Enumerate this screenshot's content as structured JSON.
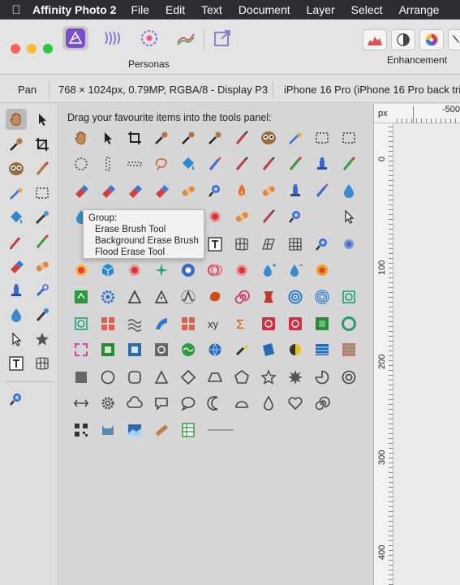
{
  "menubar": {
    "app_name": "Affinity Photo 2",
    "items": [
      "File",
      "Edit",
      "Text",
      "Document",
      "Layer",
      "Select",
      "Arrange"
    ]
  },
  "toolbar": {
    "personas_label": "Personas",
    "enhancement_label": "Enhancement"
  },
  "context": {
    "tool_name": "Pan",
    "doc_info": "768 × 1024px, 0.79MP, RGBA/8 - Display P3",
    "camera": "iPhone 16 Pro (iPhone 16 Pro back trip"
  },
  "sheet": {
    "title": "Drag your favourite items into the tools panel:"
  },
  "tooltip": {
    "heading": "Group:",
    "items": [
      "Erase Brush Tool",
      "Background Erase Brush",
      "Flood Erase Tool"
    ]
  },
  "ruler": {
    "unit": "px",
    "top_label": "-500",
    "left_labels": [
      "0",
      "100",
      "200",
      "300",
      "400"
    ]
  },
  "colors": {
    "accent": "#7b4fc9",
    "selected_tool": "#b9b9b9",
    "menubar_bg": "#2d2d2f"
  }
}
